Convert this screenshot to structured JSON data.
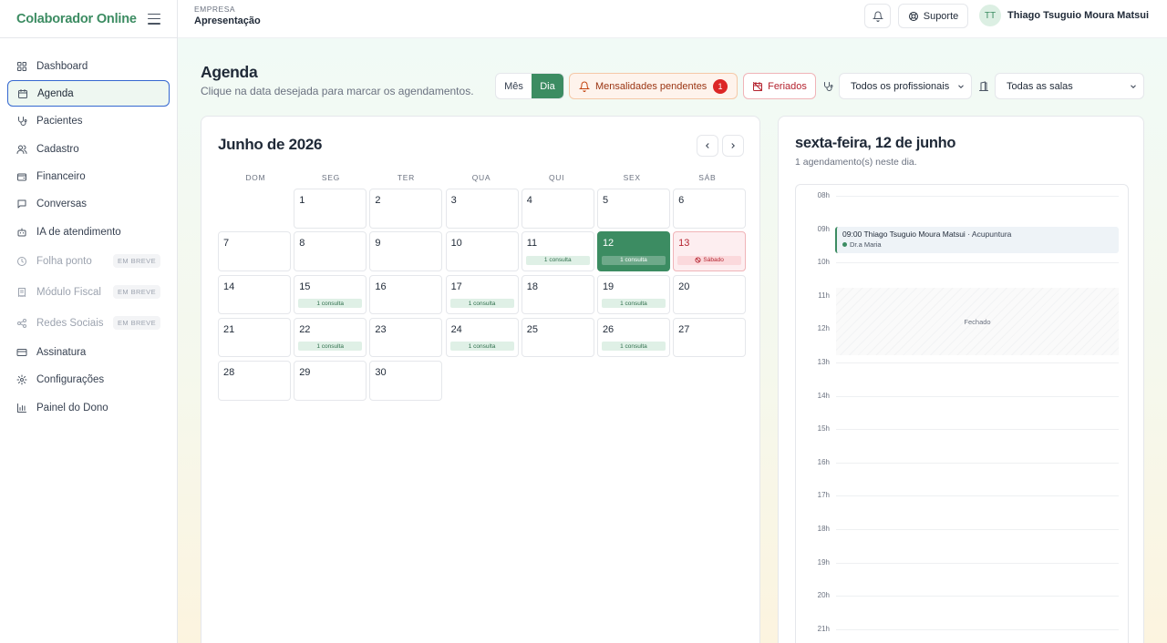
{
  "brand": {
    "name": "Colaborador Online"
  },
  "sidebar": {
    "items": [
      {
        "label": "Dashboard",
        "icon": "dashboard-icon"
      },
      {
        "label": "Agenda",
        "icon": "calendar-icon",
        "active": true
      },
      {
        "label": "Pacientes",
        "icon": "stethoscope-icon"
      },
      {
        "label": "Cadastro",
        "icon": "users-icon"
      },
      {
        "label": "Financeiro",
        "icon": "wallet-icon"
      },
      {
        "label": "Conversas",
        "icon": "chat-icon"
      },
      {
        "label": "IA de atendimento",
        "icon": "bot-icon"
      },
      {
        "label": "Folha ponto",
        "icon": "clock-icon",
        "badge": "EM BREVE"
      },
      {
        "label": "Módulo Fiscal",
        "icon": "receipt-icon",
        "badge": "EM BREVE"
      },
      {
        "label": "Redes Sociais",
        "icon": "share-icon",
        "badge": "EM BREVE"
      },
      {
        "label": "Assinatura",
        "icon": "credit-card-icon"
      },
      {
        "label": "Configurações",
        "icon": "gear-icon"
      },
      {
        "label": "Painel do Dono",
        "icon": "bar-chart-icon"
      }
    ]
  },
  "header": {
    "company_label": "EMPRESA",
    "company_name": "Apresentação",
    "support_label": "Suporte",
    "user_initials": "TT",
    "user_name": "Thiago Tsuguio Moura Matsui"
  },
  "agenda": {
    "title": "Agenda",
    "subtitle": "Clique na data desejada para marcar os agendamentos.",
    "view_month": "Mês",
    "view_day": "Dia",
    "pending_label": "Mensalidades pendentes",
    "pending_count": "1",
    "holidays_label": "Feriados",
    "professional_filter": "Todos os profissionais",
    "room_filter": "Todas as salas"
  },
  "calendar": {
    "title": "Junho de 2026",
    "weekdays": [
      "DOM",
      "SEG",
      "TER",
      "QUA",
      "QUI",
      "SEX",
      "SÁB"
    ],
    "leading_empty": 1,
    "days": [
      {
        "n": "1"
      },
      {
        "n": "2"
      },
      {
        "n": "3"
      },
      {
        "n": "4"
      },
      {
        "n": "5"
      },
      {
        "n": "6"
      },
      {
        "n": "7"
      },
      {
        "n": "8"
      },
      {
        "n": "9"
      },
      {
        "n": "10"
      },
      {
        "n": "11",
        "badge": "1 consulta"
      },
      {
        "n": "12",
        "badge": "1 consulta",
        "state": "selected"
      },
      {
        "n": "13",
        "badge": "Sábado",
        "state": "saturday"
      },
      {
        "n": "14"
      },
      {
        "n": "15",
        "badge": "1 consulta"
      },
      {
        "n": "16"
      },
      {
        "n": "17",
        "badge": "1 consulta"
      },
      {
        "n": "18"
      },
      {
        "n": "19",
        "badge": "1 consulta"
      },
      {
        "n": "20"
      },
      {
        "n": "21"
      },
      {
        "n": "22",
        "badge": "1 consulta"
      },
      {
        "n": "23"
      },
      {
        "n": "24",
        "badge": "1 consulta"
      },
      {
        "n": "25"
      },
      {
        "n": "26",
        "badge": "1 consulta"
      },
      {
        "n": "27"
      },
      {
        "n": "28"
      },
      {
        "n": "29"
      },
      {
        "n": "30"
      }
    ]
  },
  "day_view": {
    "title": "sexta-feira, 12 de junho",
    "subtitle": "1 agendamento(s) neste dia.",
    "hours": [
      "08h",
      "09h",
      "10h",
      "11h",
      "12h",
      "13h",
      "14h",
      "15h",
      "16h",
      "17h",
      "18h",
      "19h",
      "20h",
      "21h"
    ],
    "closed_label": "Fechado",
    "appointment": {
      "time_patient": "09:00 Thiago Tsuguio Moura Matsui",
      "service": "· Acupuntura",
      "professional": "Dr.a Maria"
    }
  },
  "colors": {
    "accent": "#3c8c62",
    "active_border": "#3467d0",
    "danger": "#dc2626",
    "saturday": "#b4232f"
  }
}
